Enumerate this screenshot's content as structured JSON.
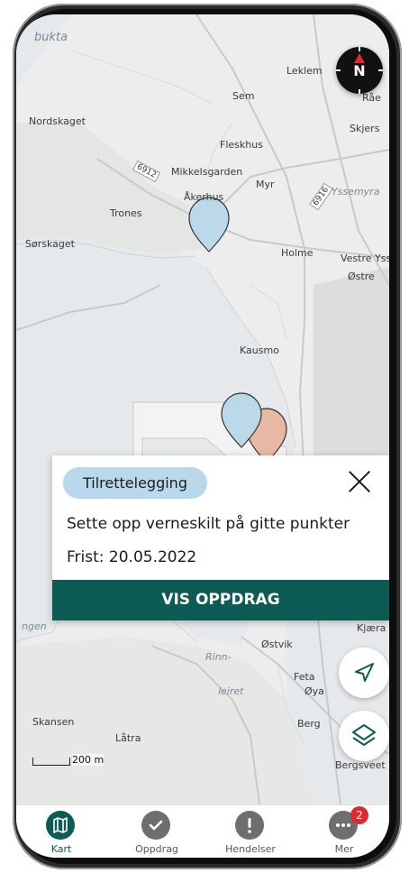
{
  "map": {
    "places": [
      {
        "label": "bukta",
        "style": "italic"
      },
      {
        "label": "Leklem",
        "style": "normal"
      },
      {
        "label": "Sem",
        "style": "normal"
      },
      {
        "label": "Nordskaget",
        "style": "normal"
      },
      {
        "label": "Skjers",
        "style": "normal"
      },
      {
        "label": "Fleskhus",
        "style": "normal"
      },
      {
        "label": "Mikkelsgarden",
        "style": "normal"
      },
      {
        "label": "Myr",
        "style": "normal"
      },
      {
        "label": "Yssemyra",
        "style": "italic"
      },
      {
        "label": "Åkerhus",
        "style": "normal"
      },
      {
        "label": "Trones",
        "style": "normal"
      },
      {
        "label": "Sørskaget",
        "style": "normal"
      },
      {
        "label": "Holme",
        "style": "normal"
      },
      {
        "label": "Vestre Yss",
        "style": "normal"
      },
      {
        "label": "Østre",
        "style": "normal"
      },
      {
        "label": "Kausmo",
        "style": "normal"
      },
      {
        "label": "Østvik",
        "style": "normal"
      },
      {
        "label": "Rinn-",
        "style": "italic"
      },
      {
        "label": "Feta",
        "style": "normal"
      },
      {
        "label": "leiret",
        "style": "italic"
      },
      {
        "label": "Øya",
        "style": "normal"
      },
      {
        "label": "Skansen",
        "style": "normal"
      },
      {
        "label": "Berg",
        "style": "normal"
      },
      {
        "label": "Låtra",
        "style": "normal"
      },
      {
        "label": "Bergsveet",
        "style": "normal"
      },
      {
        "label": "Kjæra",
        "style": "normal"
      },
      {
        "label": "ngen",
        "style": "italic"
      },
      {
        "label": "Råe",
        "style": "normal"
      }
    ],
    "road_labels": [
      "6912",
      "6916"
    ],
    "compass": {
      "label": "N",
      "needle_color": "#e0282d"
    },
    "scale_label": "200 m",
    "marker_colors": {
      "primary": "#bcd9ea",
      "secondary": "#e8b8a2"
    }
  },
  "popup": {
    "category": "Tilrettelegging",
    "title": "Sette opp verneskilt på gitte punkter",
    "deadline": "Frist: 20.05.2022",
    "action": "VIS OPPDRAG",
    "close_icon": "close-icon"
  },
  "fabs": {
    "locate_icon": "navigation-arrow-icon",
    "layers_icon": "layers-icon"
  },
  "tabs": [
    {
      "label": "Kart",
      "icon": "map-icon",
      "active": true
    },
    {
      "label": "Oppdrag",
      "icon": "checkmark-icon",
      "active": false
    },
    {
      "label": "Hendelser",
      "icon": "exclamation-icon",
      "active": false
    },
    {
      "label": "Mer",
      "icon": "more-icon",
      "active": false,
      "badge": "2"
    }
  ],
  "colors": {
    "brand": "#0c5b55",
    "badge_bg": "#b9d8ec",
    "notification": "#e0282d"
  }
}
